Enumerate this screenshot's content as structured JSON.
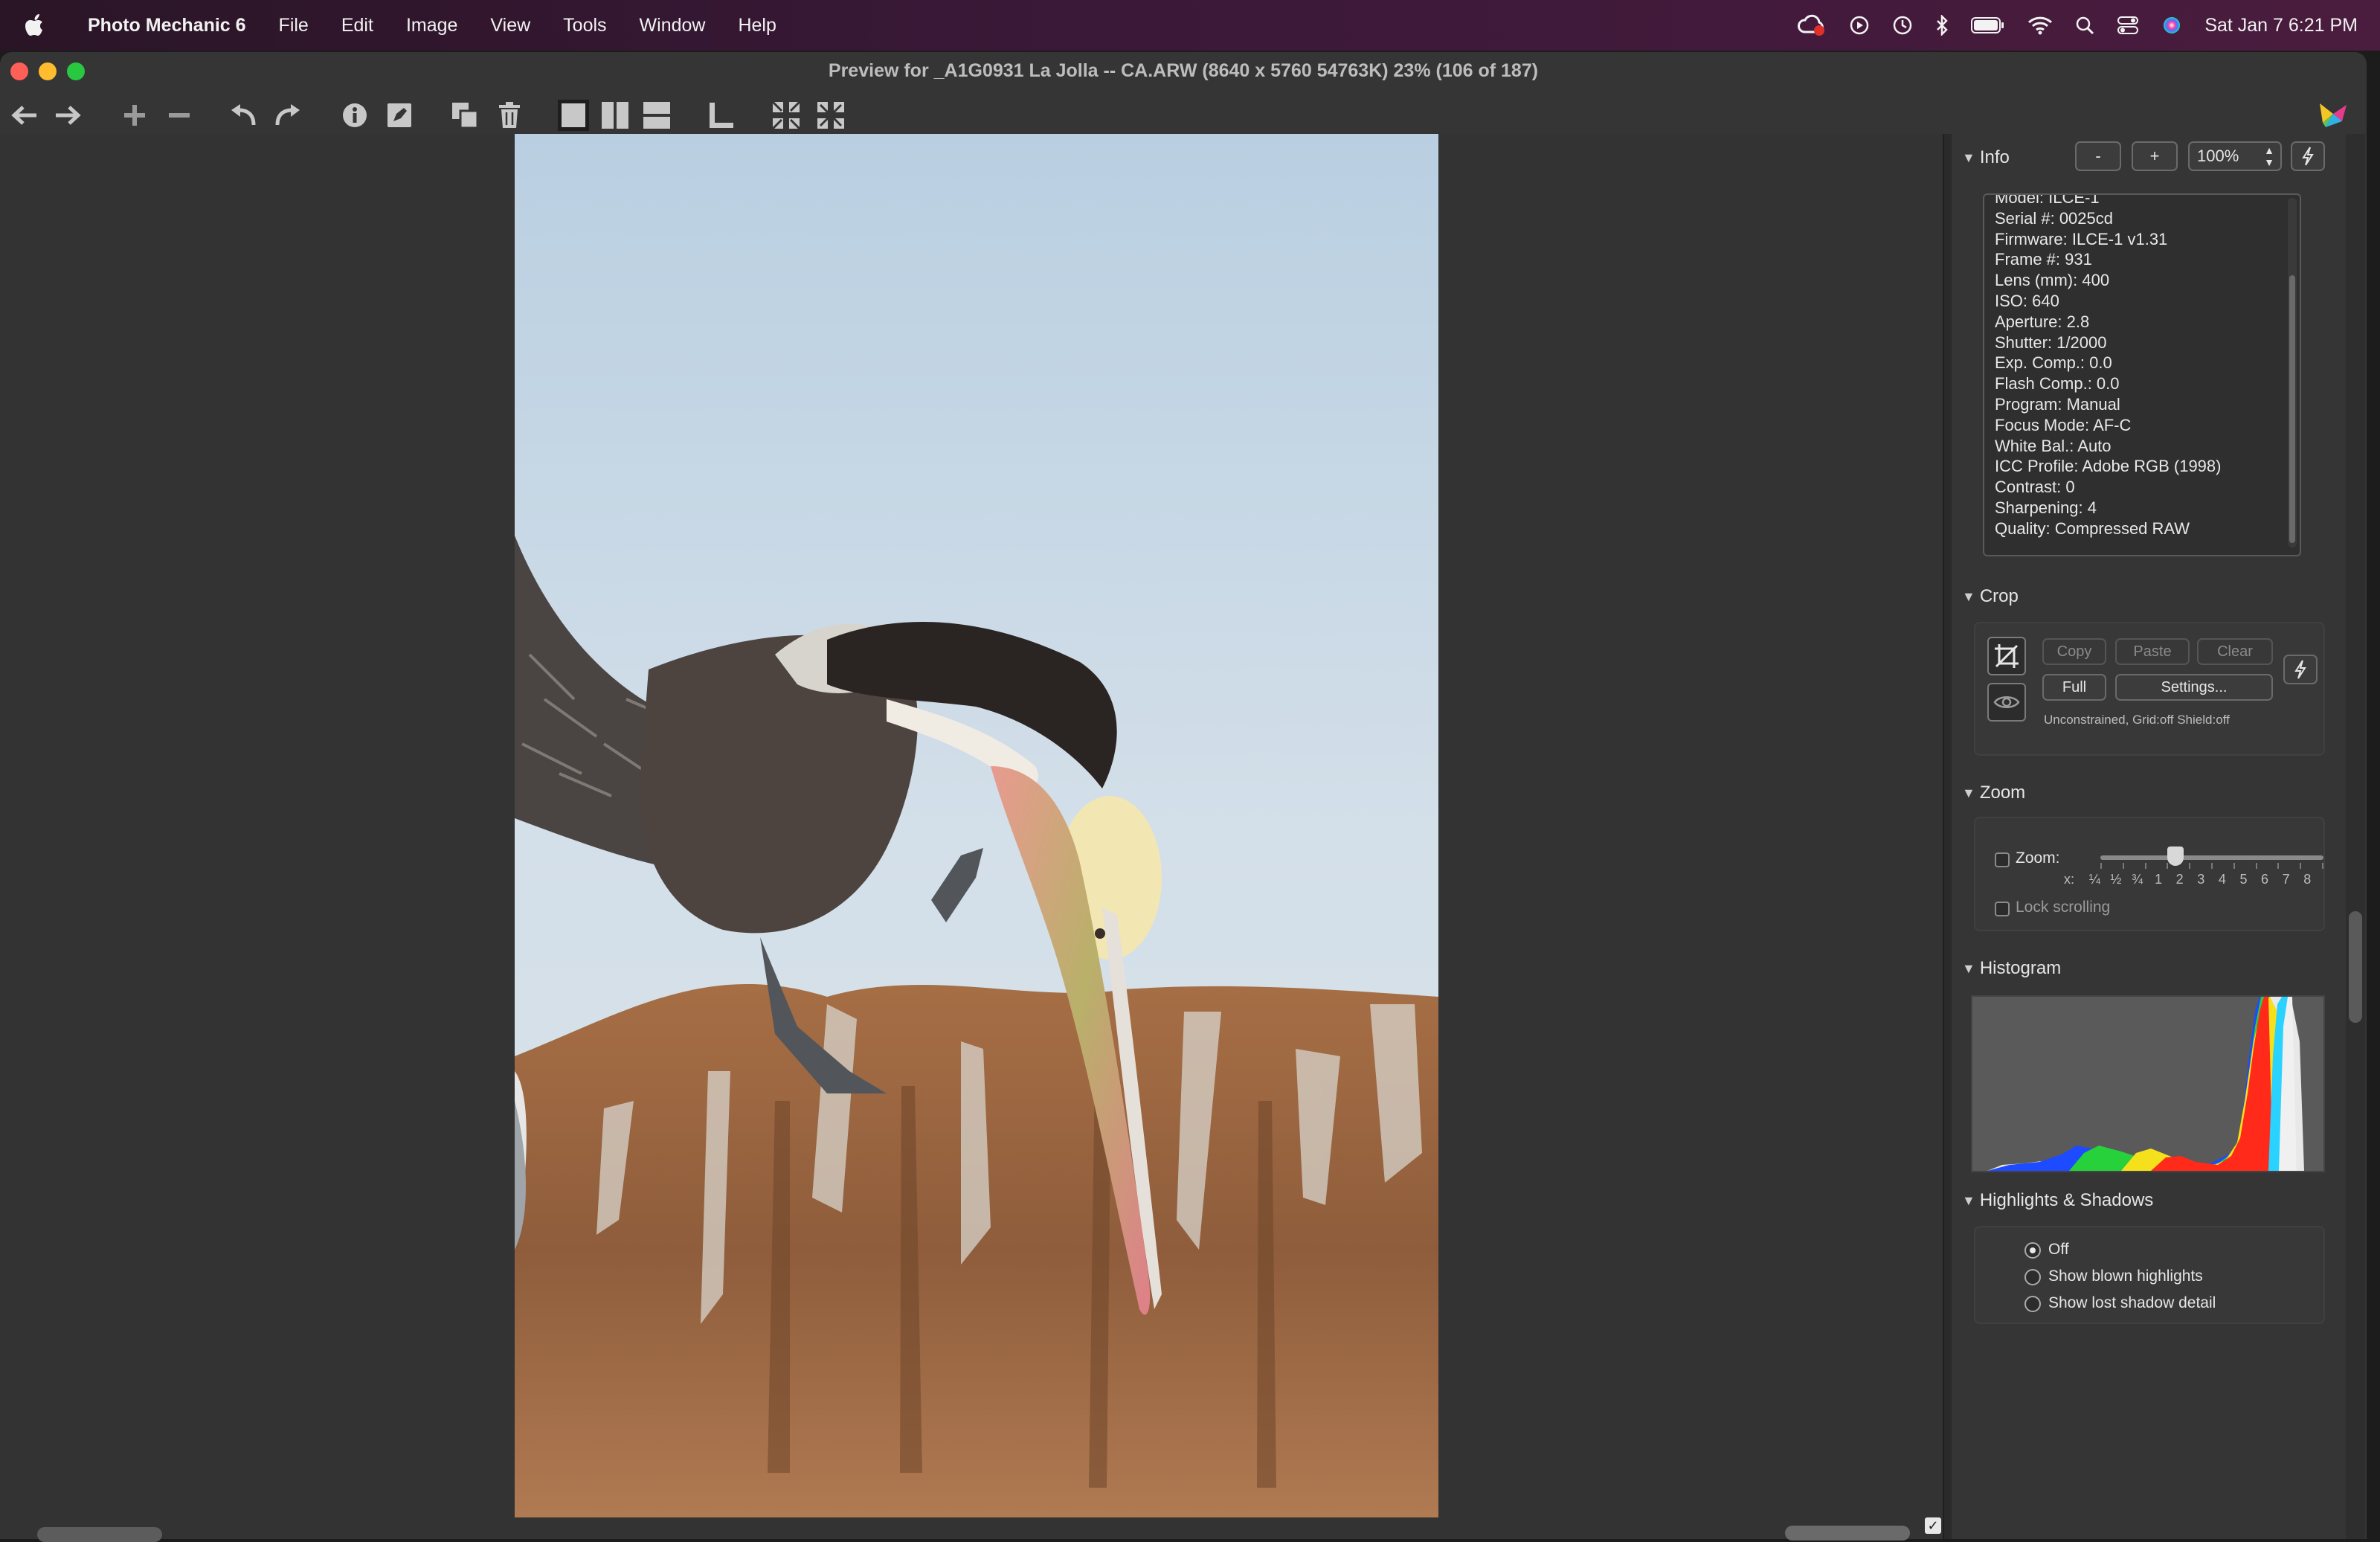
{
  "menubar": {
    "app_name": "Photo Mechanic 6",
    "menus": [
      "File",
      "Edit",
      "Image",
      "View",
      "Tools",
      "Window",
      "Help"
    ],
    "clock": "Sat Jan 7  6:21 PM",
    "status_icons": [
      "creative-cloud-icon",
      "play-circle-icon",
      "time-machine-icon",
      "bluetooth-icon",
      "battery-icon",
      "wifi-icon",
      "search-icon",
      "control-center-icon",
      "siri-icon"
    ]
  },
  "window": {
    "title": "Preview for _A1G0931 La Jolla -- CA.ARW (8640 x 5760 54763K) 23% (106 of 187)"
  },
  "toolbar": {
    "icons": [
      "back-arrow-icon",
      "forward-arrow-icon",
      "zoom-in-icon",
      "zoom-out-icon",
      "rotate-left-icon",
      "rotate-right-icon",
      "info-icon",
      "edit-icon",
      "copy-icon",
      "trash-icon",
      "single-view-icon",
      "split-vertical-icon",
      "split-horizontal-icon",
      "crop-corner-icon",
      "fit-icon",
      "fill-icon"
    ]
  },
  "panel": {
    "info": {
      "heading": "Info",
      "minus_label": "-",
      "plus_label": "+",
      "zoom_value": "100%",
      "lines": [
        "Model: ILCE-1",
        "Serial #: 0025cd",
        "Firmware: ILCE-1 v1.31",
        "Frame #: 931",
        "Lens (mm): 400",
        "ISO: 640",
        "Aperture: 2.8",
        "Shutter: 1/2000",
        "Exp. Comp.: 0.0",
        "Flash Comp.: 0.0",
        "Program: Manual",
        "Focus Mode: AF-C",
        "White Bal.: Auto",
        "ICC Profile: Adobe RGB (1998)",
        "Contrast: 0",
        "Sharpening: 4",
        "Quality: Compressed RAW"
      ]
    },
    "crop": {
      "heading": "Crop",
      "copy": "Copy",
      "paste": "Paste",
      "clear": "Clear",
      "full": "Full",
      "settings": "Settings...",
      "status": "Unconstrained, Grid:off Shield:off"
    },
    "zoom": {
      "heading": "Zoom",
      "zoom_label": "Zoom:",
      "scale_prefix": "x:",
      "scale": [
        "¼",
        "½",
        "¾",
        "1",
        "2",
        "3",
        "4",
        "5",
        "6",
        "7",
        "8"
      ],
      "lock_label": "Lock scrolling"
    },
    "histogram": {
      "heading": "Histogram"
    },
    "highlights": {
      "heading": "Highlights & Shadows",
      "options": [
        "Off",
        "Show blown highlights",
        "Show lost shadow detail"
      ],
      "selected": "Off"
    }
  }
}
